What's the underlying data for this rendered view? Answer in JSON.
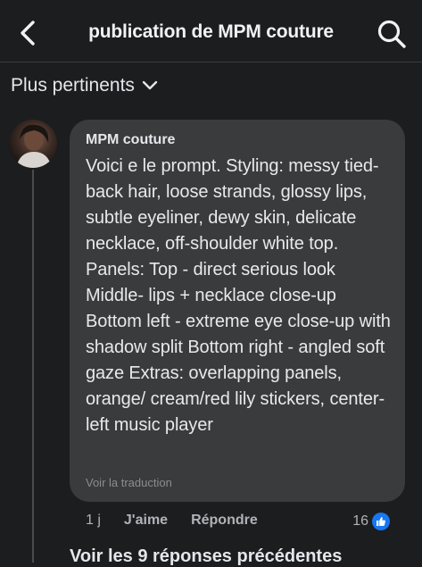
{
  "header": {
    "title": "publication de MPM couture",
    "back_icon": "chevron-left-icon",
    "search_icon": "search-icon"
  },
  "sort": {
    "label": "Plus pertinents",
    "icon": "chevron-down-icon"
  },
  "comment": {
    "author": "MPM couture",
    "text": "Voici e le prompt. Styling: messy tied-back hair, loose strands, glossy lips, subtle eyeliner, dewy skin, delicate necklace, off-shoulder white top. Panels: Top - direct serious look Middle- lips + necklace close-up Bottom left - extreme eye close-up with shadow split Bottom right - angled soft gaze Extras: overlapping panels, orange/ cream/red lily stickers, center-left music player",
    "translate_label": "Voir la traduction",
    "time": "1 j",
    "like_label": "J'aime",
    "reply_label": "Répondre",
    "reaction_count": "16"
  },
  "replies": {
    "more_label": "Voir les 9 réponses précédentes"
  },
  "colors": {
    "background": "#1c1d1f",
    "bubble": "#3a3b3c",
    "like_blue": "#1877f2"
  }
}
